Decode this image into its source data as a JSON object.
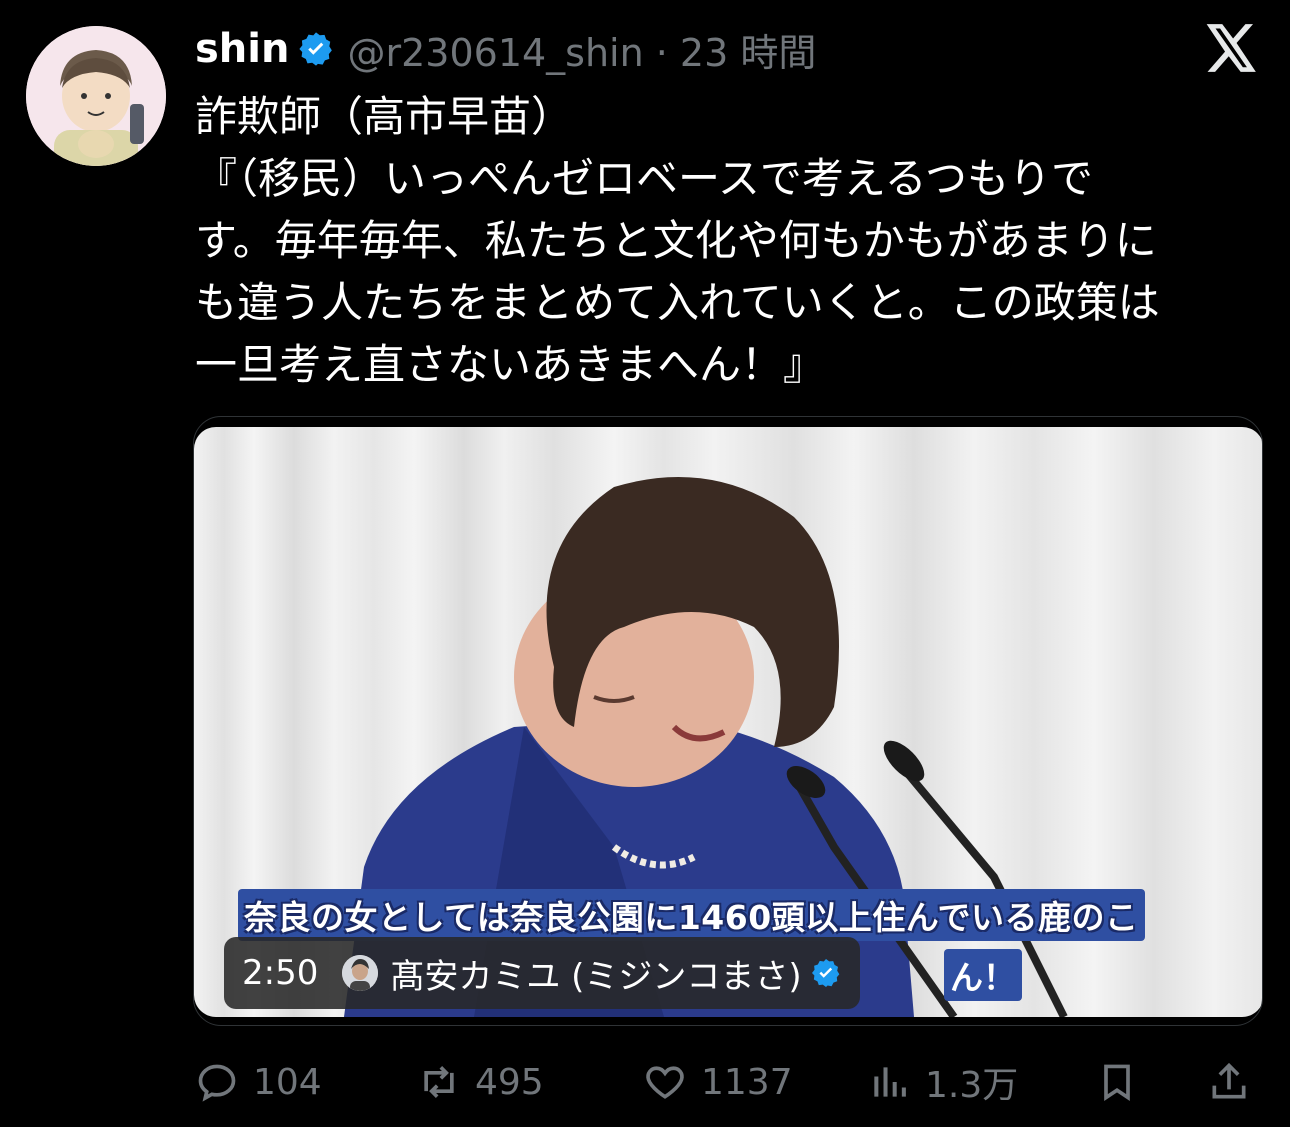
{
  "author": {
    "display_name": "shin",
    "handle_time": "@r230614_shin · 23 時間"
  },
  "tweet": {
    "lines": [
      "詐欺師（高市早苗）",
      "『（移民）いっぺんゼロベースで考えるつもりで",
      "す。毎年毎年、私たちと文化や何もかもがあまりに",
      "も違う人たちをまとめて入れていくと。この政策は",
      "一旦考え直さないあきまへん！』"
    ]
  },
  "media": {
    "subtitle_line": "奈良の女としては奈良公園に1460頭以上住んでいる鹿のこ",
    "subtitle_tail": "ん！",
    "duration": "2:50",
    "source_name": "髙安カミユ (ミジンコまさ)"
  },
  "actions": {
    "replies": "104",
    "reposts": "495",
    "likes": "1137",
    "views": "1.3万"
  },
  "colors": {
    "background": "#000000",
    "text": "#ffffff",
    "muted": "#71767b",
    "verified": "#1d9bf0"
  }
}
